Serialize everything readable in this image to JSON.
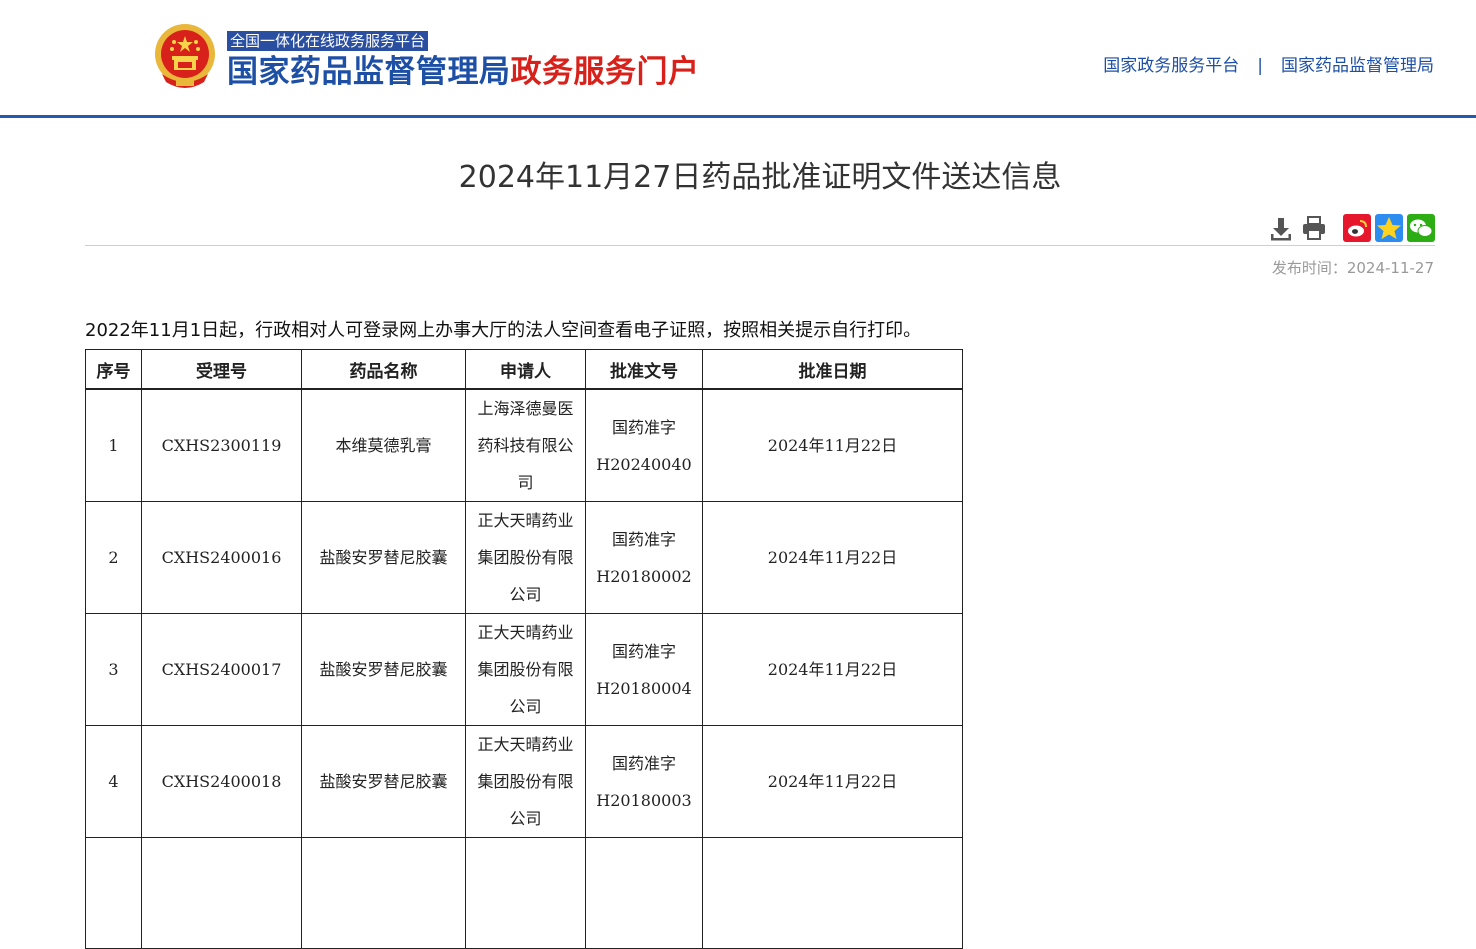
{
  "header": {
    "platform_tag": "全国一体化在线政务服务平台",
    "site_name_blue": "国家药品监督管理局",
    "site_name_red": "政务服务门户",
    "links": [
      "国家政务服务平台",
      "国家药品监督管理局"
    ],
    "link_separator": "|"
  },
  "article": {
    "title": "2024年11月27日药品批准证明文件送达信息",
    "publish_date": "发布时间：2024-11-27",
    "intro": "2022年11月1日起，行政相对人可登录网上办事大厅的法人空间查看电子证照，按照相关提示自行打印。",
    "tools": [
      "download-icon",
      "print-icon",
      "weibo-icon",
      "qzone-icon",
      "wechat-icon"
    ]
  },
  "table": {
    "headers": [
      "序号",
      "受理号",
      "药品名称",
      "申请人",
      "批准文号",
      "批准日期"
    ],
    "rows": [
      {
        "no": "1",
        "accept_no": "CXHS2300119",
        "drug": "本维莫德乳膏",
        "applicant": "上海泽德曼医药科技有限公司",
        "approval_prefix": "国药准字",
        "approval_no": "H20240040",
        "date": "2024年11月22日"
      },
      {
        "no": "2",
        "accept_no": "CXHS2400016",
        "drug": "盐酸安罗替尼胶囊",
        "applicant": "正大天晴药业集团股份有限公司",
        "approval_prefix": "国药准字",
        "approval_no": "H20180002",
        "date": "2024年11月22日"
      },
      {
        "no": "3",
        "accept_no": "CXHS2400017",
        "drug": "盐酸安罗替尼胶囊",
        "applicant": "正大天晴药业集团股份有限公司",
        "approval_prefix": "国药准字",
        "approval_no": "H20180004",
        "date": "2024年11月22日"
      },
      {
        "no": "4",
        "accept_no": "CXHS2400018",
        "drug": "盐酸安罗替尼胶囊",
        "applicant": "正大天晴药业集团股份有限公司",
        "approval_prefix": "国药准字",
        "approval_no": "H20180003",
        "date": "2024年11月22日"
      }
    ]
  },
  "colors": {
    "brand_blue": "#1d4fa5",
    "brand_red": "#d8211a",
    "header_rule": "#2459b3"
  }
}
